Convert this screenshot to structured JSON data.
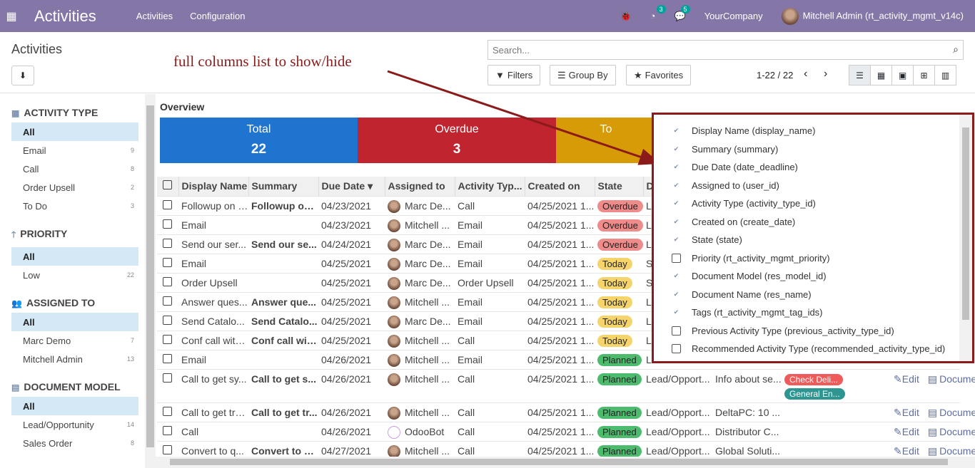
{
  "topbar": {
    "app_title": "Activities",
    "menus": [
      "Activities",
      "Configuration"
    ],
    "badge1": "3",
    "badge2": "5",
    "company": "YourCompany",
    "user": "Mitchell Admin (rt_activity_mgmt_v14c)"
  },
  "control": {
    "breadcrumb": "Activities",
    "search_placeholder": "Search...",
    "filters": "Filters",
    "group_by": "Group By",
    "favorites": "Favorites",
    "pager": "1-22 / 22"
  },
  "annotation": "full columns list to show/hide",
  "sidebar": {
    "groups": [
      {
        "title": "ACTIVITY TYPE",
        "icon": "▦",
        "items": [
          {
            "label": "All",
            "count": ""
          },
          {
            "label": "Email",
            "count": "9"
          },
          {
            "label": "Call",
            "count": "8"
          },
          {
            "label": "Order Upsell",
            "count": "2"
          },
          {
            "label": "To Do",
            "count": "3"
          }
        ]
      },
      {
        "title": "PRIORITY",
        "icon": "🡑",
        "items": [
          {
            "label": "All",
            "count": ""
          },
          {
            "label": "Low",
            "count": "22"
          }
        ]
      },
      {
        "title": "ASSIGNED TO",
        "icon": "👥",
        "items": [
          {
            "label": "All",
            "count": ""
          },
          {
            "label": "Marc Demo",
            "count": "7"
          },
          {
            "label": "Mitchell Admin",
            "count": "13"
          }
        ]
      },
      {
        "title": "DOCUMENT MODEL",
        "icon": "▤",
        "items": [
          {
            "label": "All",
            "count": ""
          },
          {
            "label": "Lead/Opportunity",
            "count": "14"
          },
          {
            "label": "Sales Order",
            "count": "8"
          }
        ]
      }
    ]
  },
  "overview": {
    "title": "Overview",
    "tiles": [
      {
        "label": "Total",
        "value": "22",
        "color": "#1f74cf"
      },
      {
        "label": "Overdue",
        "value": "3",
        "color": "#c0242f"
      },
      {
        "label": "To",
        "value": "",
        "color": "#d79b08"
      }
    ]
  },
  "table": {
    "headers": [
      "Display Name",
      "Summary",
      "Due Date ▾",
      "Assigned to",
      "Activity Typ...",
      "Created on",
      "State",
      "D"
    ],
    "rows": [
      {
        "name": "Followup on t...",
        "summary": "Followup on...",
        "due": "04/23/2021",
        "user": "Marc De...",
        "type": "Call",
        "created": "04/25/2021 1...",
        "state": "Overdue",
        "doc": "L",
        "extra": "",
        "tags": []
      },
      {
        "name": "Email",
        "summary": "",
        "due": "04/23/2021",
        "user": "Mitchell ...",
        "type": "Email",
        "created": "04/25/2021 1...",
        "state": "Overdue",
        "doc": "L",
        "extra": "",
        "tags": []
      },
      {
        "name": "Send our ser...",
        "summary": "Send our se...",
        "due": "04/24/2021",
        "user": "Marc De...",
        "type": "Email",
        "created": "04/25/2021 1...",
        "state": "Overdue",
        "doc": "L",
        "extra": "",
        "tags": []
      },
      {
        "name": "Email",
        "summary": "",
        "due": "04/25/2021",
        "user": "Marc De...",
        "type": "Email",
        "created": "04/25/2021 1...",
        "state": "Today",
        "doc": "S",
        "extra": "",
        "tags": []
      },
      {
        "name": "Order Upsell",
        "summary": "",
        "due": "04/25/2021",
        "user": "Marc De...",
        "type": "Order Upsell",
        "created": "04/25/2021 1...",
        "state": "Today",
        "doc": "S",
        "extra": "",
        "tags": []
      },
      {
        "name": "Answer ques...",
        "summary": "Answer que...",
        "due": "04/25/2021",
        "user": "Mitchell ...",
        "type": "Email",
        "created": "04/25/2021 1...",
        "state": "Today",
        "doc": "L",
        "extra": "",
        "tags": []
      },
      {
        "name": "Send Catalo...",
        "summary": "Send Catalo...",
        "due": "04/25/2021",
        "user": "Marc De...",
        "type": "Email",
        "created": "04/25/2021 1...",
        "state": "Today",
        "doc": "L",
        "extra": "",
        "tags": []
      },
      {
        "name": "Conf call with...",
        "summary": "Conf call wit...",
        "due": "04/25/2021",
        "user": "Mitchell ...",
        "type": "Call",
        "created": "04/25/2021 1...",
        "state": "Today",
        "doc": "L",
        "extra": "",
        "tags": []
      },
      {
        "name": "Email",
        "summary": "",
        "due": "04/26/2021",
        "user": "Mitchell ...",
        "type": "Email",
        "created": "04/25/2021 1...",
        "state": "Planned",
        "doc": "L",
        "extra": "",
        "tags": []
      },
      {
        "name": "Call to get sy...",
        "summary": "Call to get s...",
        "due": "04/26/2021",
        "user": "Mitchell ...",
        "type": "Call",
        "created": "04/25/2021 1...",
        "state": "Planned",
        "doc": "Lead/Opport...",
        "extra": "Info about se...",
        "tags": [
          {
            "label": "Check Deli...",
            "color": "#ef5b5b"
          },
          {
            "label": "General En...",
            "color": "#2e9591"
          }
        ]
      },
      {
        "name": "Call to get tra...",
        "summary": "Call to get tr...",
        "due": "04/26/2021",
        "user": "Mitchell ...",
        "type": "Call",
        "created": "04/25/2021 1...",
        "state": "Planned",
        "doc": "Lead/Opport...",
        "extra": "DeltaPC: 10 ...",
        "tags": []
      },
      {
        "name": "Call",
        "summary": "",
        "due": "04/26/2021",
        "user": "OdooBot",
        "type": "Call",
        "created": "04/25/2021 1...",
        "state": "Planned",
        "doc": "Lead/Opport...",
        "extra": "Distributor C...",
        "tags": []
      },
      {
        "name": "Convert to q...",
        "summary": "Convert to q...",
        "due": "04/27/2021",
        "user": "Mitchell ...",
        "type": "Call",
        "created": "04/25/2021 1...",
        "state": "Planned",
        "doc": "Lead/Opport...",
        "extra": "Global Soluti...",
        "tags": []
      }
    ],
    "edit_label": "Edit",
    "document_label": "Document"
  },
  "columns_popup": [
    {
      "label": "Display Name (display_name)",
      "checked": true
    },
    {
      "label": "Summary (summary)",
      "checked": true
    },
    {
      "label": "Due Date (date_deadline)",
      "checked": true
    },
    {
      "label": "Assigned to (user_id)",
      "checked": true
    },
    {
      "label": "Activity Type (activity_type_id)",
      "checked": true
    },
    {
      "label": "Created on (create_date)",
      "checked": true
    },
    {
      "label": "State (state)",
      "checked": true
    },
    {
      "label": "Priority (rt_activity_mgmt_priority)",
      "checked": false
    },
    {
      "label": "Document Model (res_model_id)",
      "checked": true
    },
    {
      "label": "Document Name (res_name)",
      "checked": true
    },
    {
      "label": "Tags (rt_activity_mgmt_tag_ids)",
      "checked": true
    },
    {
      "label": "Previous Activity Type (previous_activity_type_id)",
      "checked": false
    },
    {
      "label": "Recommended Activity Type (recommended_activity_type_id)",
      "checked": false
    }
  ]
}
